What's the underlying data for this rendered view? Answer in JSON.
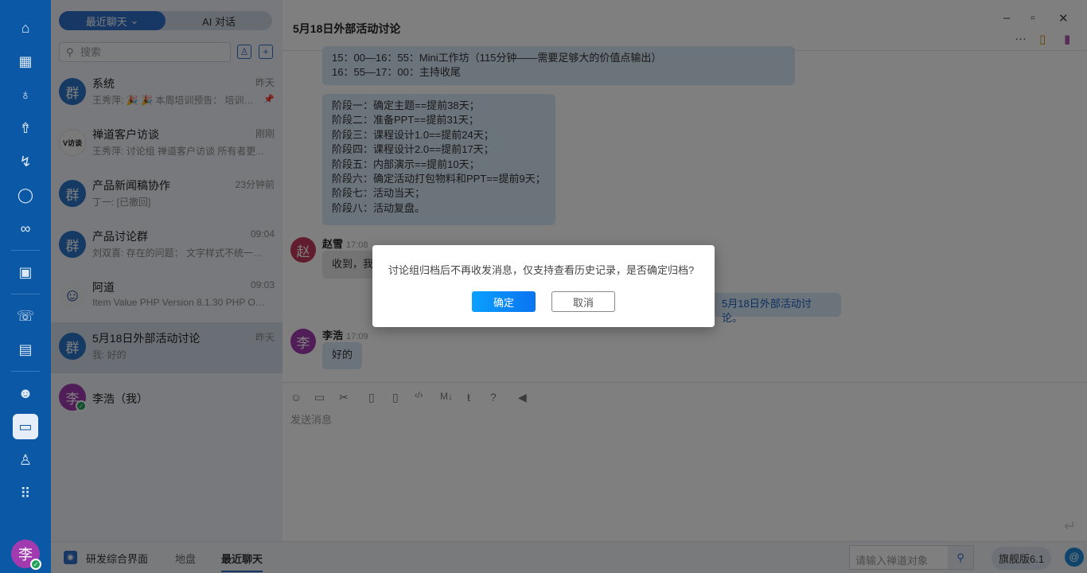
{
  "sidebar": {
    "icons": [
      "home-icon",
      "apps-icon",
      "bulb-icon",
      "rocket-icon",
      "runner-icon",
      "search-icon",
      "infinity-icon",
      "presentation-icon",
      "handshake-icon",
      "document-icon",
      "team-icon",
      "chat-icon",
      "user-icon",
      "grid-icon"
    ],
    "me_avatar": "李"
  },
  "list": {
    "tabs": [
      "最近聊天",
      "AI 对话"
    ],
    "search_placeholder": "搜索",
    "chats": [
      {
        "avatar": "群",
        "name": "系统",
        "time": "昨天",
        "preview": "王秀萍: 🎉 🎉 本周培训预告： 培训主...",
        "pinned": true
      },
      {
        "avatar": "V访谈",
        "name": "禅道客户访谈",
        "time": "刚刚",
        "preview": "王秀萍: 讨论组 禅道客户访谈 所有者更..."
      },
      {
        "avatar": "群",
        "name": "产品新闻稿协作",
        "time": "23分钟前",
        "preview": "丁一: [已撤回]"
      },
      {
        "avatar": "群",
        "name": "产品讨论群",
        "time": "09:04",
        "preview": "刘双喜: 存在的问题： 文字样式不统一；..."
      },
      {
        "avatar": "☺",
        "name": "阿道",
        "time": "09:03",
        "preview": "Item Value PHP Version 8.1.30 PHP OS..."
      },
      {
        "avatar": "群",
        "name": "5月18日外部活动讨论",
        "time": "昨天",
        "preview": "我: 好的",
        "selected": true
      },
      {
        "avatar": "李",
        "name": "李浩（我）",
        "time": "",
        "preview": ""
      }
    ]
  },
  "chat": {
    "title": "5月18日外部活动讨论",
    "schedule": [
      "15：00—16：55：Mini工作坊（115分钟——需要足够大的价值点输出）",
      "16：55—17：00：主持收尾"
    ],
    "stages": [
      "阶段一：确定主题==提前38天；",
      "阶段二：准备PPT==提前31天；",
      "阶段三：课程设计1.0==提前24天；",
      "阶段四：课程设计2.0==提前17天；",
      "阶段五：内部演示==提前10天；",
      "阶段六：确定活动打包物料和PPT==提前9天；",
      "阶段七：活动当天；",
      "阶段八：活动复盘。"
    ],
    "msg1": {
      "avatar": "赵",
      "sender": "赵雪",
      "time": "17:08",
      "text": "收到，我"
    },
    "notice": "5月18日外部活动讨论。",
    "msg2": {
      "avatar": "李",
      "sender": "李浩",
      "time": "17:09",
      "text": "好的"
    },
    "composer_placeholder": "发送消息"
  },
  "bottombar": {
    "app": "研发综合界面",
    "crumbs": [
      "地盘",
      "最近聊天"
    ],
    "search_placeholder": "请输入禅道对象",
    "version": "旗舰版6.1"
  },
  "dialog": {
    "message": "讨论组归档后不再收发消息，仅支持查看历史记录，是否确定归档?",
    "ok": "确定",
    "cancel": "取消"
  }
}
